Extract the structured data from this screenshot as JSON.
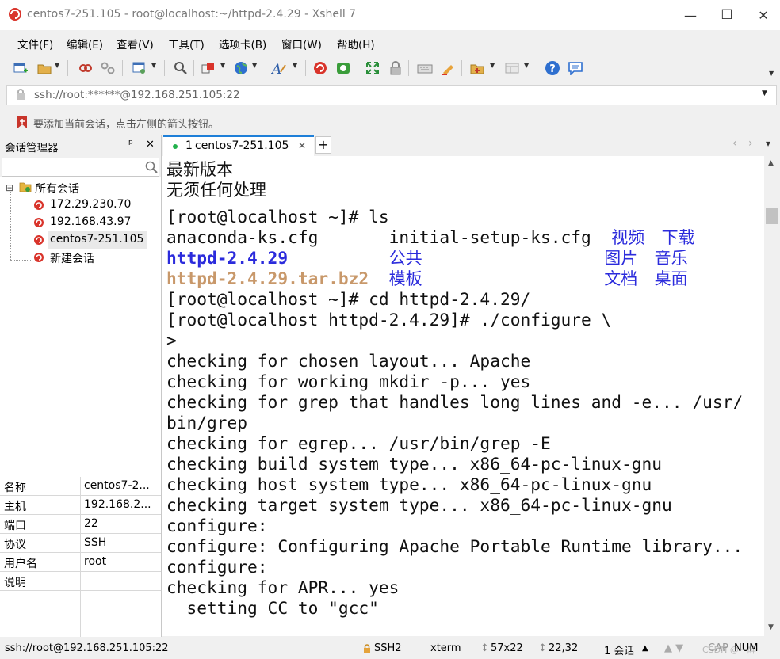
{
  "window": {
    "title": "centos7-251.105 - root@localhost:~/httpd-2.4.29 - Xshell 7",
    "minimize_glyph": "—",
    "maximize_glyph": "☐",
    "close_glyph": "✕"
  },
  "menu": [
    "文件(F)",
    "编辑(E)",
    "查看(V)",
    "工具(T)",
    "选项卡(B)",
    "窗口(W)",
    "帮助(H)"
  ],
  "toolbar": {
    "icons": [
      "new-session-icon",
      "open-folder-icon",
      "connect-icon",
      "disconnect-icon",
      "properties-icon",
      "find-icon",
      "transfer-icon",
      "globe-icon",
      "font-icon",
      "xshell-icon",
      "xftp-icon",
      "fullscreen-icon",
      "lock-icon",
      "keyboard-icon",
      "highlight-icon",
      "add-folder-icon",
      "layout-icon",
      "help-icon",
      "chat-icon"
    ]
  },
  "address": {
    "text": "ssh://root:******@192.168.251.105:22"
  },
  "hint": {
    "text": "要添加当前会话，点击左侧的箭头按钮。"
  },
  "session_manager": {
    "title": "会话管理器",
    "pin_glyph": "ᵖ",
    "close_glyph": "✕",
    "root": {
      "toggle": "⊟",
      "label": "所有会话"
    },
    "items": [
      {
        "label": "172.29.230.70"
      },
      {
        "label": "192.168.43.97"
      },
      {
        "label": "centos7-251.105"
      },
      {
        "label": "新建会话"
      }
    ]
  },
  "properties": [
    {
      "key": "名称",
      "value": "centos7-2..."
    },
    {
      "key": "主机",
      "value": "192.168.2..."
    },
    {
      "key": "端口",
      "value": "22"
    },
    {
      "key": "协议",
      "value": "SSH"
    },
    {
      "key": "用户名",
      "value": "root"
    },
    {
      "key": "说明",
      "value": ""
    }
  ],
  "tabs": {
    "active": {
      "number": "1",
      "label": "centos7-251.105",
      "close": "✕"
    },
    "add": "+",
    "nav_prev": "‹",
    "nav_next": "›",
    "menu": "▾"
  },
  "terminal": {
    "lines": [
      {
        "segments": [
          {
            "text": "最新版本",
            "color": "#111111",
            "cjk": true
          }
        ]
      },
      {
        "segments": [
          {
            "text": "无须任何处理",
            "color": "#111111",
            "cjk": true
          }
        ]
      },
      {
        "segments": [
          {
            "text": "[root@localhost ~]# ls",
            "color": "#111111"
          }
        ]
      },
      {
        "segments": [
          {
            "text": "anaconda-ks.cfg       initial-setup-ks.cfg  ",
            "color": "#111111"
          },
          {
            "text": "视频  下载",
            "color": "#2b2bdc",
            "cjk": true,
            "spaced": true
          }
        ]
      },
      {
        "segments": [
          {
            "text": "httpd-2.4.29",
            "color": "#2b2bdc",
            "bold": true
          },
          {
            "text": "          ",
            "color": "#111111"
          },
          {
            "text": "公共",
            "color": "#2b2bdc",
            "cjk": true
          },
          {
            "text": "                  ",
            "color": "#111111"
          },
          {
            "text": "图片  音乐",
            "color": "#2b2bdc",
            "cjk": true,
            "spaced": true
          }
        ]
      },
      {
        "segments": [
          {
            "text": "httpd-2.4.29.tar.bz2",
            "color": "#c8986a",
            "bold": true
          },
          {
            "text": "  ",
            "color": "#111111"
          },
          {
            "text": "模板",
            "color": "#2b2bdc",
            "cjk": true
          },
          {
            "text": "                  ",
            "color": "#111111"
          },
          {
            "text": "文档  桌面",
            "color": "#2b2bdc",
            "cjk": true,
            "spaced": true
          }
        ]
      },
      {
        "segments": [
          {
            "text": "[root@localhost ~]# cd httpd-2.4.29/",
            "color": "#111111"
          }
        ]
      },
      {
        "segments": [
          {
            "text": "[root@localhost httpd-2.4.29]# ./configure \\",
            "color": "#111111"
          }
        ]
      },
      {
        "segments": [
          {
            "text": ">",
            "color": "#111111"
          }
        ]
      },
      {
        "segments": [
          {
            "text": "checking for chosen layout... Apache",
            "color": "#111111"
          }
        ]
      },
      {
        "segments": [
          {
            "text": "checking for working mkdir -p... yes",
            "color": "#111111"
          }
        ]
      },
      {
        "segments": [
          {
            "text": "checking for grep that handles long lines and -e... /usr/",
            "color": "#111111"
          }
        ]
      },
      {
        "segments": [
          {
            "text": "bin/grep",
            "color": "#111111"
          }
        ]
      },
      {
        "segments": [
          {
            "text": "checking for egrep... /usr/bin/grep -E",
            "color": "#111111"
          }
        ]
      },
      {
        "segments": [
          {
            "text": "checking build system type... x86_64-pc-linux-gnu",
            "color": "#111111"
          }
        ]
      },
      {
        "segments": [
          {
            "text": "checking host system type... x86_64-pc-linux-gnu",
            "color": "#111111"
          }
        ]
      },
      {
        "segments": [
          {
            "text": "checking target system type... x86_64-pc-linux-gnu",
            "color": "#111111"
          }
        ]
      },
      {
        "segments": [
          {
            "text": "configure:",
            "color": "#111111"
          }
        ]
      },
      {
        "segments": [
          {
            "text": "configure: Configuring Apache Portable Runtime library...",
            "color": "#111111"
          }
        ]
      },
      {
        "segments": [
          {
            "text": "configure:",
            "color": "#111111"
          }
        ]
      },
      {
        "segments": [
          {
            "text": "checking for APR... yes",
            "color": "#111111"
          }
        ]
      },
      {
        "segments": [
          {
            "text": "  setting CC to \"gcc\"",
            "color": "#111111"
          }
        ]
      }
    ]
  },
  "statusbar": {
    "connection": "ssh://root@192.168.251.105:22",
    "protocol": "SSH2",
    "term": "xterm",
    "size_glyph": "↕",
    "size": "57x22",
    "cursor_glyph": "↕",
    "cursor": "22,32",
    "sessions": "1 会话",
    "sessions_arrow": "▲",
    "watermark": "CSDN @一醉",
    "caps": "CAP",
    "num": "NUM"
  },
  "colors": {
    "accent": "#1e7fd8",
    "xshell_red": "#d9342b",
    "terminal_blue": "#2b2bdc",
    "terminal_archive": "#c8986a"
  }
}
